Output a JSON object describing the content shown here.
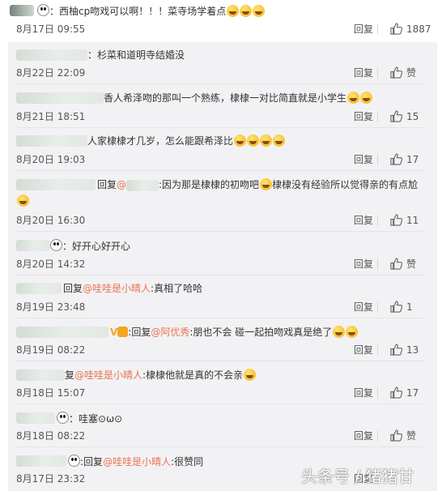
{
  "ui": {
    "reply_label": "回复"
  },
  "comments": [
    {
      "prefix": "：",
      "text": "西柚cp吻戏可以啊！！！菜寺场学着点",
      "date": "8月17日 09:55",
      "likes": "1887"
    },
    {
      "prefix": "：",
      "text": "杉菜和道明寺结婚没",
      "date": "8月22日 22:09",
      "likes": "赞"
    },
    {
      "text": "香人希泽吻的那叫一个熟练，棣棣一对比简直就是小学生",
      "date": "8月21日 18:51",
      "likes": "15"
    },
    {
      "text": "人家棣棣才几岁，怎么能跟希泽比",
      "date": "8月20日 19:03",
      "likes": "17"
    },
    {
      "reply_word": "回复",
      "mention": "@",
      "text": ":因为那是棣棣的初吻吧",
      "text2": "棣棣没有经验所以觉得亲的有点尬",
      "date": "8月20日 16:30",
      "likes": "11"
    },
    {
      "prefix": "：",
      "text": "好开心好开心",
      "date": "8月20日 14:32",
      "likes": "赞"
    },
    {
      "reply_word": "回复",
      "mention": "@哇哇是小晴人",
      "text": ":真相了哈哈",
      "date": "8月19日 23:48",
      "likes": "1"
    },
    {
      "badge_prefix": "V",
      "prefix": ":",
      "reply_word": "回复",
      "mention": "@阿优秀",
      "text": ":朋也不会 碰一起拍吻戏真是绝了",
      "date": "8月19日 08:22",
      "likes": "13"
    },
    {
      "reply_word": "复",
      "mention": "@哇哇是小晴人",
      "text": ":棣棣他就是真的不会亲",
      "date": "8月18日 15:07",
      "likes": "17"
    },
    {
      "prefix": "：",
      "text": "哇塞⊙ω⊙",
      "date": "8月18日 08:22",
      "likes": "赞"
    },
    {
      "prefix": ":",
      "reply_word": "回复",
      "mention": "@哇哇是小晴人",
      "text": ":很赞同",
      "date": "8月17日 23:32",
      "likes": ""
    }
  ],
  "watermark": "头条号 / 猪猪甘",
  "colors": {
    "link": "#eb7350",
    "text": "#333333",
    "meta": "#555555",
    "sub_bg": "#f2f2f5"
  },
  "icons": {
    "emoji": "laugh-cry-emoji",
    "thumb": "thumbs-up-icon",
    "panda": "panda-icon"
  }
}
